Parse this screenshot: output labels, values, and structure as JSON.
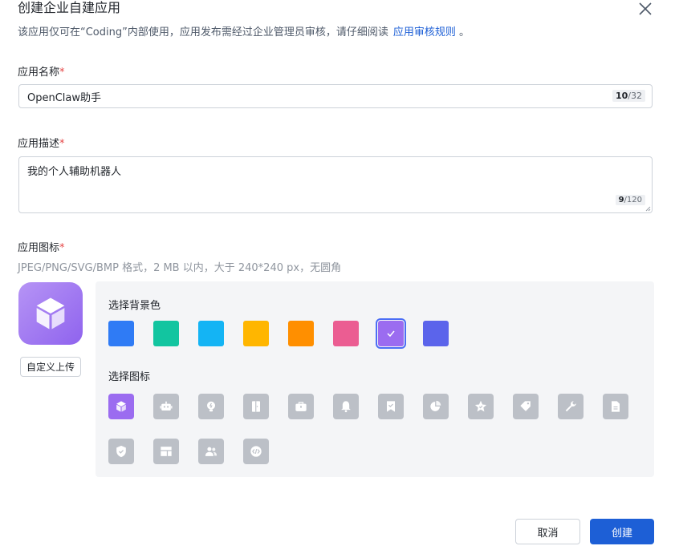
{
  "dialog": {
    "title": "创建企业自建应用",
    "subtitle": "该应用仅可在“Coding”内部使用，应用发布需经过企业管理员审核，请仔细阅读",
    "subtitle_link": "应用审核规则",
    "subtitle_end": "。"
  },
  "name_field": {
    "label": "应用名称",
    "required_mark": "*",
    "value": "OpenClaw助手",
    "count": "10",
    "max": "/32"
  },
  "desc_field": {
    "label": "应用描述",
    "required_mark": "*",
    "value": "我的个人辅助机器人",
    "count": "9",
    "max": "/120"
  },
  "icon_field": {
    "label": "应用图标",
    "required_mark": "*",
    "hint": "JPEG/PNG/SVG/BMP 格式，2 MB 以内，大于 240*240 px，无圆角",
    "upload_label": "自定义上传"
  },
  "bg_colors": {
    "label": "选择背景色",
    "options": [
      "#2f7bf5",
      "#12c5a0",
      "#14b4f4",
      "#ffb600",
      "#ff8f00",
      "#eb5d92",
      "#9b6cf0",
      "#5b64eb"
    ],
    "selected_index": 6
  },
  "icons": {
    "label": "选择图标",
    "options": [
      "cube-icon",
      "robot-icon",
      "bulb-icon",
      "door-icon",
      "briefcase-icon",
      "bell-icon",
      "bookmark-check-icon",
      "pie-chart-icon",
      "star-icon",
      "tag-icon",
      "wrench-icon",
      "document-icon",
      "shield-check-icon",
      "layout-icon",
      "users-icon",
      "code-icon"
    ],
    "selected_index": 0
  },
  "footer": {
    "cancel_label": "取消",
    "create_label": "创建"
  }
}
